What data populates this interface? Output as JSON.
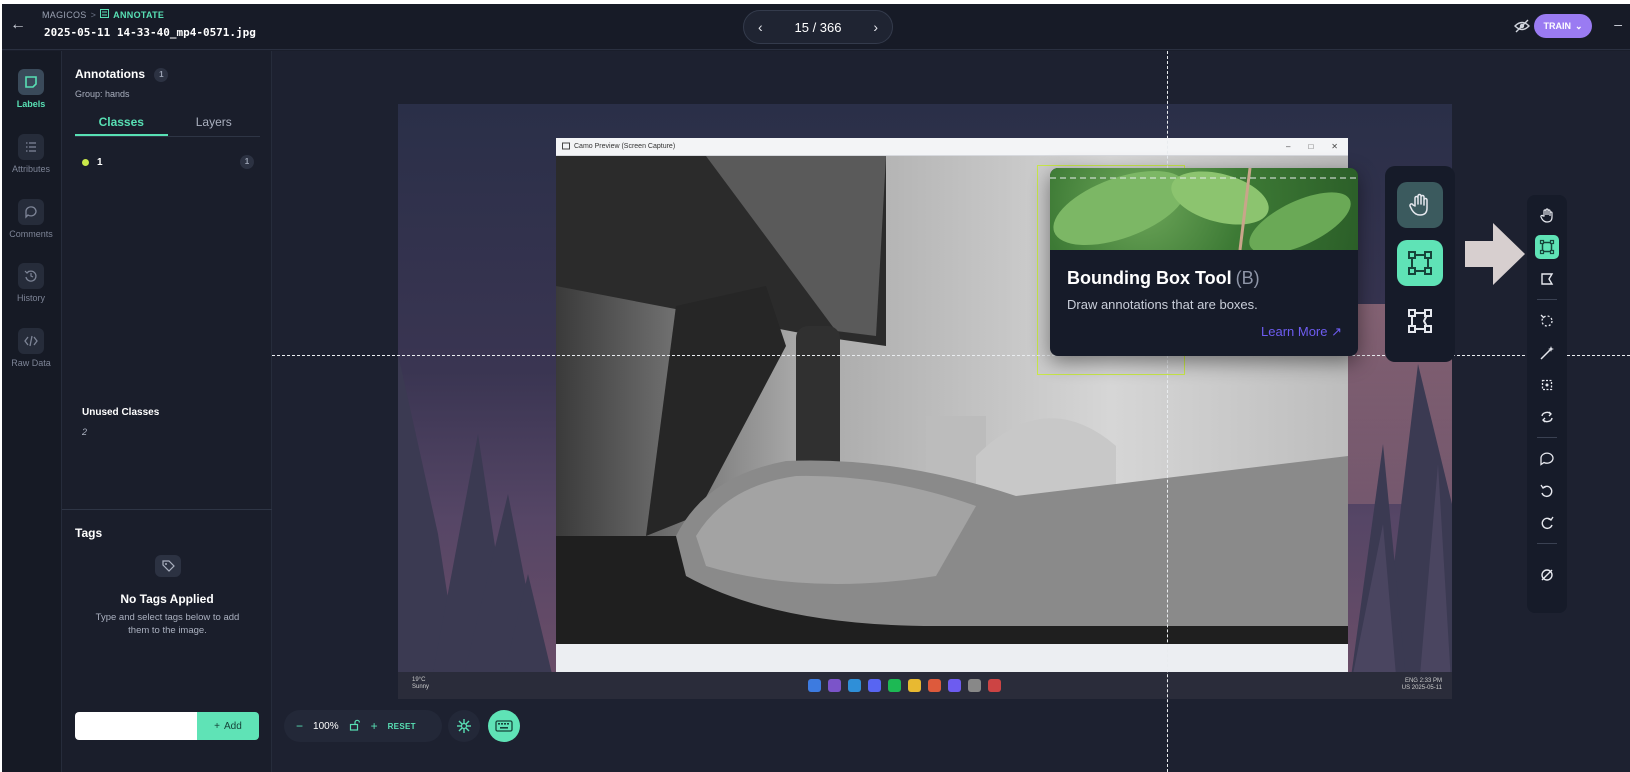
{
  "header": {
    "breadcrumb_root": "MAGICOS",
    "breadcrumb_separator": ">",
    "breadcrumb_current": "ANNOTATE",
    "filename": "2025-05-11 14-33-40_mp4-0571.jpg",
    "pager_text": "15 / 366",
    "train_label": "TRAIN"
  },
  "rail": {
    "items": [
      {
        "label": "Labels",
        "icon": "label-icon"
      },
      {
        "label": "Attributes",
        "icon": "list-icon"
      },
      {
        "label": "Comments",
        "icon": "comment-icon"
      },
      {
        "label": "History",
        "icon": "history-icon"
      },
      {
        "label": "Raw Data",
        "icon": "code-icon"
      }
    ]
  },
  "panel": {
    "annotations_title": "Annotations",
    "annotations_count": "1",
    "group_label": "Group:",
    "group_value": "hands",
    "tabs": [
      {
        "label": "Classes"
      },
      {
        "label": "Layers"
      }
    ],
    "classes": [
      {
        "name": "1",
        "count": "1",
        "color": "#c9e84a"
      }
    ],
    "unused_title": "Unused Classes",
    "unused_items": [
      "2"
    ],
    "tags_title": "Tags",
    "no_tags_title": "No Tags Applied",
    "no_tags_desc": "Type and select tags below to add them to the image.",
    "tag_input_value": "",
    "add_label": "Add"
  },
  "canvas": {
    "window_title": "Camo Preview (Screen Capture)",
    "weather_temp": "19°C",
    "weather_desc": "Sunny",
    "tray_lang": "ENG",
    "tray_region": "US",
    "tray_time": "2:33 PM",
    "tray_date": "2025-05-11"
  },
  "tooltip": {
    "title": "Bounding Box Tool",
    "shortcut": "(B)",
    "description": "Draw annotations that are boxes.",
    "link": "Learn More ↗"
  },
  "zoom": {
    "minus": "−",
    "level": "100%",
    "plus": "+",
    "reset_label": "RESET"
  },
  "colors": {
    "accent": "#5fe3b6",
    "brand_purple": "#9a7bf2",
    "class_1": "#c9e84a",
    "link": "#6d5cf0"
  }
}
